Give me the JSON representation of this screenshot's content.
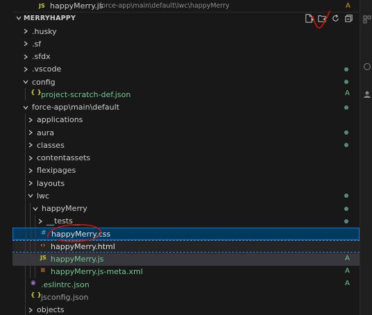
{
  "open_editor": {
    "file_name": "happyMerry.js",
    "path": "force-app\\main\\default\\lwc\\happyMerry",
    "type_badge": "JS",
    "status": "A"
  },
  "explorer": {
    "title": "MERRYHAPPY",
    "actions": [
      "new-file-icon",
      "new-folder-icon",
      "refresh-icon",
      "collapse-all-icon"
    ]
  },
  "tree": [
    {
      "label": ".husky",
      "kind": "folder",
      "open": false,
      "depth": 1,
      "status": "",
      "dot": false
    },
    {
      "label": ".sf",
      "kind": "folder",
      "open": false,
      "depth": 1,
      "status": "",
      "dot": false
    },
    {
      "label": ".sfdx",
      "kind": "folder",
      "open": false,
      "depth": 1,
      "status": "",
      "dot": false
    },
    {
      "label": ".vscode",
      "kind": "folder",
      "open": false,
      "depth": 1,
      "status": "",
      "dot": true
    },
    {
      "label": "config",
      "kind": "folder",
      "open": true,
      "depth": 1,
      "status": "",
      "dot": true
    },
    {
      "label": "project-scratch-def.json",
      "kind": "json",
      "depth": 2,
      "status": "A",
      "dot": false
    },
    {
      "label": "force-app\\main\\default",
      "kind": "folder",
      "open": true,
      "depth": 1,
      "status": "",
      "dot": true
    },
    {
      "label": "applications",
      "kind": "folder",
      "open": false,
      "depth": 2,
      "status": "",
      "dot": false
    },
    {
      "label": "aura",
      "kind": "folder",
      "open": false,
      "depth": 2,
      "status": "",
      "dot": true
    },
    {
      "label": "classes",
      "kind": "folder",
      "open": false,
      "depth": 2,
      "status": "",
      "dot": true
    },
    {
      "label": "contentassets",
      "kind": "folder",
      "open": false,
      "depth": 2,
      "status": "",
      "dot": false
    },
    {
      "label": "flexipages",
      "kind": "folder",
      "open": false,
      "depth": 2,
      "status": "",
      "dot": false
    },
    {
      "label": "layouts",
      "kind": "folder",
      "open": false,
      "depth": 2,
      "status": "",
      "dot": false
    },
    {
      "label": "lwc",
      "kind": "folder",
      "open": true,
      "depth": 2,
      "status": "",
      "dot": true
    },
    {
      "label": "happyMerry",
      "kind": "folder",
      "open": true,
      "depth": 3,
      "status": "",
      "dot": true
    },
    {
      "label": "__tests__",
      "kind": "folder",
      "open": false,
      "depth": 4,
      "status": "",
      "dot": true
    },
    {
      "label": "happyMerry.css",
      "kind": "css",
      "depth": 4,
      "status": "",
      "dot": false,
      "state": "selected"
    },
    {
      "label": "happyMerry.html",
      "kind": "html",
      "depth": 4,
      "status": "",
      "dot": false,
      "state": "dashed"
    },
    {
      "label": "happyMerry.js",
      "kind": "js",
      "depth": 4,
      "status": "A",
      "dot": false,
      "state": "focus-js"
    },
    {
      "label": "happyMerry.js-meta.xml",
      "kind": "xml",
      "depth": 4,
      "status": "A",
      "dot": false
    },
    {
      "label": ".eslintrc.json",
      "kind": "eslint",
      "depth": 2,
      "status": "A",
      "dot": false
    },
    {
      "label": "jsconfig.json",
      "kind": "json",
      "depth": 2,
      "status": "",
      "dot": false,
      "dim": true
    },
    {
      "label": "objects",
      "kind": "folder",
      "open": false,
      "depth": 2,
      "status": "",
      "dot": false
    }
  ],
  "icons": {
    "json": "{ }",
    "css": "#",
    "html": "<>",
    "js": "JS",
    "xml": "rss",
    "eslint": "o"
  },
  "colors": {
    "json": "#cbcb41",
    "css": "#519aba",
    "html": "#e37933",
    "js": "#cbcb41",
    "xml": "#e37933",
    "eslint": "#a074c4",
    "status_added": "#73c991",
    "status_modified": "#cca700",
    "annotation": "#e51400",
    "selection": "#0078d4"
  }
}
